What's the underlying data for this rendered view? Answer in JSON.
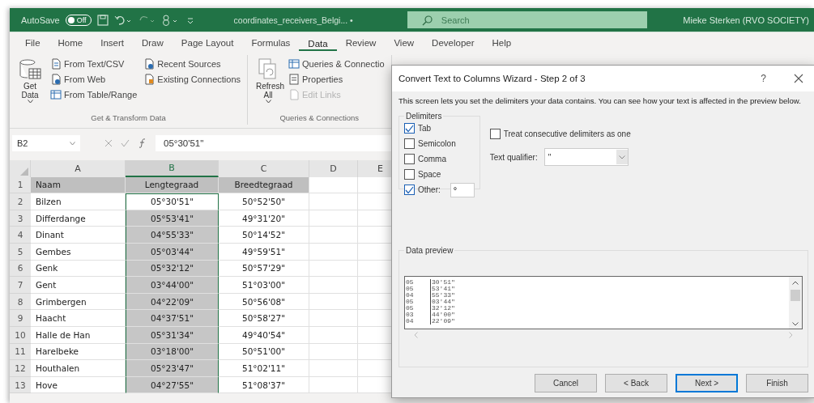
{
  "title_bar": {
    "autosave_label": "AutoSave",
    "autosave_toggle": {
      "label": "Off",
      "on": false
    },
    "document_title": "coordinates_receivers_Belgi... •",
    "search": {
      "placeholder": "Search"
    },
    "user": "Mieke Sterken (RVO SOCIETY)"
  },
  "ribbon_tabs": [
    {
      "label": "File",
      "selected": false
    },
    {
      "label": "Home",
      "selected": false
    },
    {
      "label": "Insert",
      "selected": false
    },
    {
      "label": "Draw",
      "selected": false
    },
    {
      "label": "Page Layout",
      "selected": false
    },
    {
      "label": "Formulas",
      "selected": false
    },
    {
      "label": "Data",
      "selected": true
    },
    {
      "label": "Review",
      "selected": false
    },
    {
      "label": "View",
      "selected": false
    },
    {
      "label": "Developer",
      "selected": false
    },
    {
      "label": "Help",
      "selected": false
    }
  ],
  "ribbon_groups": [
    {
      "label": "Get & Transform Data",
      "large_button": {
        "kind": "get",
        "label": "Get Data"
      },
      "columns": [
        [
          {
            "kind": "text",
            "label": "From Text/CSV",
            "disabled": false
          },
          {
            "kind": "web",
            "label": "From Web",
            "disabled": false
          },
          {
            "kind": "table",
            "label": "From Table/Range",
            "disabled": false
          }
        ],
        [
          {
            "kind": "recent",
            "label": "Recent Sources",
            "disabled": false
          },
          {
            "kind": "existing",
            "label": "Existing Connections",
            "disabled": false
          }
        ]
      ]
    },
    {
      "label": "Queries & Connections",
      "large_button": {
        "kind": "refresh",
        "label": "Refresh All"
      },
      "columns": [
        [
          {
            "kind": "queries",
            "label": "Queries & Connectio",
            "disabled": false
          },
          {
            "kind": "properties",
            "label": "Properties",
            "disabled": false
          },
          {
            "kind": "links",
            "label": "Edit Links",
            "disabled": true
          }
        ]
      ]
    }
  ],
  "formula_bar": {
    "name_box": "B2",
    "formula": "05°30'51\""
  },
  "sheet": {
    "columns": [
      {
        "label": "A",
        "selected": false
      },
      {
        "label": "B",
        "selected": true
      },
      {
        "label": "C",
        "selected": false
      },
      {
        "label": "D",
        "selected": false
      },
      {
        "label": "E",
        "selected": false
      }
    ],
    "rows": [
      {
        "number": "1",
        "kind": "header",
        "active": false,
        "cells": [
          "Naam",
          "Lengtegraad",
          "Breedtegraad"
        ]
      },
      {
        "number": "2",
        "kind": "data",
        "active": true,
        "cells": [
          "Bilzen",
          "05°30'51\"",
          "50°52'50\""
        ]
      },
      {
        "number": "3",
        "kind": "data",
        "active": false,
        "cells": [
          "Differdange",
          "05°53'41\"",
          "49°31'20\""
        ]
      },
      {
        "number": "4",
        "kind": "data",
        "active": false,
        "cells": [
          "Dinant",
          "04°55'33\"",
          "50°14'52\""
        ]
      },
      {
        "number": "5",
        "kind": "data",
        "active": false,
        "cells": [
          "Gembes",
          "05°03'44\"",
          "49°59'51\""
        ]
      },
      {
        "number": "6",
        "kind": "data",
        "active": false,
        "cells": [
          "Genk",
          "05°32'12\"",
          "50°57'29\""
        ]
      },
      {
        "number": "7",
        "kind": "data",
        "active": false,
        "cells": [
          "Gent",
          "03°44'00\"",
          "51°03'00\""
        ]
      },
      {
        "number": "8",
        "kind": "data",
        "active": false,
        "cells": [
          "Grimbergen",
          "04°22'09\"",
          "50°56'08\""
        ]
      },
      {
        "number": "9",
        "kind": "data",
        "active": false,
        "cells": [
          "Haacht",
          "04°37'51\"",
          "50°58'27\""
        ]
      },
      {
        "number": "10",
        "kind": "data",
        "active": false,
        "cells": [
          "Halle de Han",
          "05°31'34\"",
          "49°40'54\""
        ]
      },
      {
        "number": "11",
        "kind": "data",
        "active": false,
        "cells": [
          "Harelbeke",
          "03°18'00\"",
          "50°51'00\""
        ]
      },
      {
        "number": "12",
        "kind": "data",
        "active": false,
        "cells": [
          "Houthalen",
          "05°23'47\"",
          "51°02'11\""
        ]
      },
      {
        "number": "13",
        "kind": "data",
        "active": false,
        "cells": [
          "Hove",
          "04°27'55\"",
          "51°08'37\""
        ]
      }
    ]
  },
  "dialog": {
    "title": "Convert Text to Columns Wizard - Step 2 of 3",
    "help_label": "?",
    "description": "This screen lets you set the delimiters your data contains.  You can see how your text is affected in the preview below.",
    "delimiters": {
      "label": "Delimiters",
      "options": [
        {
          "label": "Tab",
          "checked": true
        },
        {
          "label": "Semicolon",
          "checked": false
        },
        {
          "label": "Comma",
          "checked": false
        },
        {
          "label": "Space",
          "checked": false
        },
        {
          "label": "Other:",
          "checked": true,
          "value": "°"
        }
      ]
    },
    "consecutive": {
      "label": "Treat consecutive delimiters as one",
      "checked": false
    },
    "text_qualifier": {
      "label": "Text qualifier:",
      "value": "\""
    },
    "preview": {
      "label": "Data preview",
      "rows": [
        [
          "05",
          "30'51\""
        ],
        [
          "05",
          "53'41\""
        ],
        [
          "04",
          "55'33\""
        ],
        [
          "05",
          "03'44\""
        ],
        [
          "05",
          "32'12\""
        ],
        [
          "03",
          "44'00\""
        ],
        [
          "04",
          "22'09\""
        ]
      ]
    },
    "buttons": [
      {
        "label": "Cancel",
        "default": false
      },
      {
        "label": "< Back",
        "default": false
      },
      {
        "label": "Next >",
        "default": true
      },
      {
        "label": "Finish",
        "default": false
      }
    ]
  }
}
